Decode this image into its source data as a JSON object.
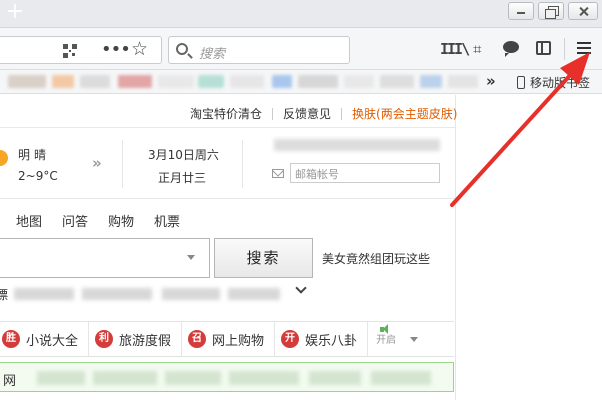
{
  "titlebar": {
    "new_tab_symbol": "+"
  },
  "toolbar": {
    "search_placeholder": "搜索",
    "more_symbol": "•••",
    "star_symbol": "☆",
    "library_symbol": "III\\",
    "crop_symbol": "⌗"
  },
  "bookmarks": {
    "overflow_symbol": "»",
    "mobile_label": "移动版书签"
  },
  "page": {
    "top_links": [
      "淘宝特价清仓",
      "反馈意见",
      "换肤(两会主题皮肤)"
    ],
    "weather": {
      "condition": "明晴",
      "temp": "2~9°C",
      "arrow": "»"
    },
    "date": {
      "solar": "3月10日周六",
      "lunar": "正月廿三"
    },
    "mail_placeholder": "邮箱帐号",
    "search_tabs": [
      "地图",
      "问答",
      "购物",
      "机票"
    ],
    "search_button": "搜索",
    "hot_link": "美女竟然组团玩这些",
    "hot_row_prefix": "漂",
    "categories": [
      {
        "badge": "胜",
        "label": "小说大全"
      },
      {
        "badge": "利",
        "label": "旅游度假"
      },
      {
        "badge": "召",
        "label": "网上购物"
      },
      {
        "badge": "开",
        "label": "娱乐八卦"
      }
    ],
    "speaker_label": "开启",
    "green_row_text": "网"
  },
  "colors": {
    "accent_orange": "#e05c00",
    "badge_red": "#d43b3b",
    "annotation_red": "#e8302a"
  }
}
